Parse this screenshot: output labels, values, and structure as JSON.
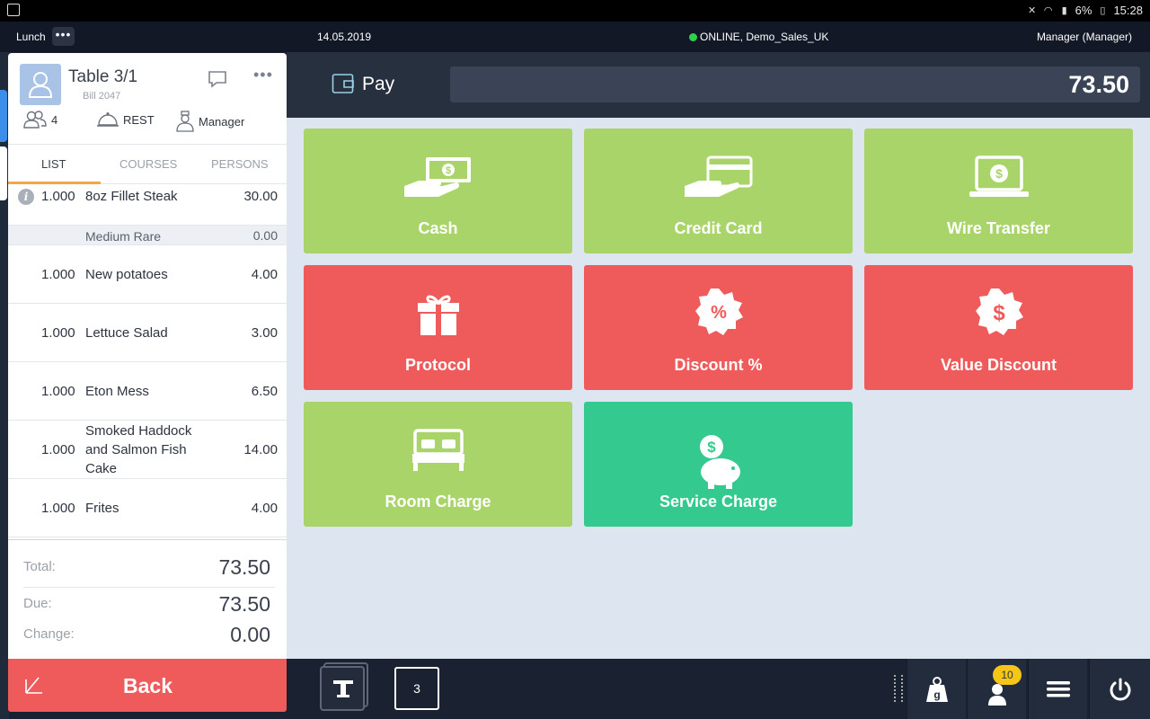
{
  "status_bar": {
    "battery": "6%",
    "time": "15:28"
  },
  "app_bar": {
    "session": "Lunch",
    "more": "•••",
    "date": "14.05.2019",
    "connection": "ONLINE, Demo_Sales_UK",
    "user": "Manager (Manager)"
  },
  "order": {
    "table": "Table 3/1",
    "bill": "Bill 2047",
    "more": "•••",
    "guests": "4",
    "location": "REST",
    "waiter": "Manager",
    "tabs": [
      "LIST",
      "COURSES",
      "PERSONS"
    ],
    "items": [
      {
        "qty": "1.000",
        "name": "8oz Fillet Steak",
        "price": "30.00",
        "modifier": "Medium Rare",
        "modifier_price": "0.00"
      },
      {
        "qty": "1.000",
        "name": "New potatoes",
        "price": "4.00"
      },
      {
        "qty": "1.000",
        "name": "Lettuce Salad",
        "price": "3.00"
      },
      {
        "qty": "1.000",
        "name": "Eton Mess",
        "price": "6.50"
      },
      {
        "qty": "1.000",
        "name": "Smoked Haddock and Salmon Fish Cake",
        "price": "14.00"
      },
      {
        "qty": "1.000",
        "name": "Frites",
        "price": "4.00"
      }
    ],
    "totals": {
      "total_label": "Total:",
      "total": "73.50",
      "due_label": "Due:",
      "due": "73.50",
      "change_label": "Change:",
      "change": "0.00"
    },
    "back_label": "Back"
  },
  "pay": {
    "title": "Pay",
    "amount": "73.50",
    "tiles": [
      {
        "label": "Cash",
        "color": "#a8d46a"
      },
      {
        "label": "Credit Card",
        "color": "#a8d46a"
      },
      {
        "label": "Wire Transfer",
        "color": "#a8d46a"
      },
      {
        "label": "Protocol",
        "color": "#ef5a5a"
      },
      {
        "label": "Discount %",
        "color": "#ef5a5a"
      },
      {
        "label": "Value Discount",
        "color": "#ef5a5a"
      },
      {
        "label": "Room Charge",
        "color": "#a8d46a"
      },
      {
        "label": "Service Charge",
        "color": "#33c98f"
      }
    ]
  },
  "bottom_bar": {
    "count": "3",
    "badge": "10",
    "icons": [
      "table-icon",
      "scale-icon",
      "waiter-icon",
      "menu-icon",
      "power-icon"
    ]
  }
}
